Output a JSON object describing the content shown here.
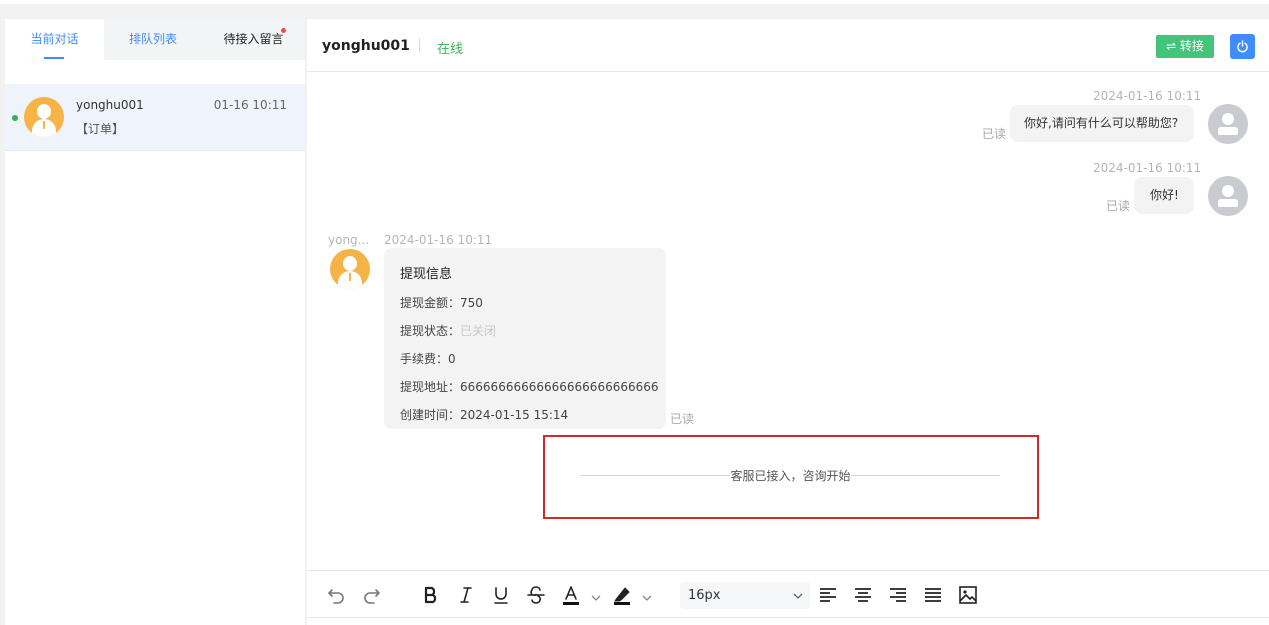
{
  "sidebar": {
    "tabs": [
      {
        "label": "当前对话"
      },
      {
        "label": "排队列表"
      },
      {
        "label": "待接入留言"
      }
    ],
    "conversation": {
      "name": "yonghu001",
      "time": "01-16 10:11",
      "preview": "【订单】"
    }
  },
  "chat": {
    "header": {
      "name": "yonghu001",
      "status": "在线",
      "transfer_label": "⇌ 转接",
      "power_icon": "power-icon"
    },
    "messages": [
      {
        "side": "right",
        "time": "2024-01-16 10:11",
        "text": "你好,请问有什么可以帮助您?",
        "read": "已读"
      },
      {
        "side": "right",
        "time": "2024-01-16 10:11",
        "text": "你好!",
        "read": "已读"
      }
    ],
    "card_message": {
      "sender": "yong...",
      "time": "2024-01-16 10:11",
      "title": "提现信息",
      "rows": [
        {
          "label": "提现金额：",
          "value": "750"
        },
        {
          "label": "提现状态：",
          "value": "已关闭"
        },
        {
          "label": "手续费：",
          "value": "0"
        },
        {
          "label": "提现地址：",
          "value": "66666666666666666666666666"
        },
        {
          "label": "创建时间：",
          "value": "2024-01-15 15:14"
        }
      ],
      "read": "已读"
    },
    "system_notice": "客服已接入，咨询开始"
  },
  "editor": {
    "toolbar_icons": [
      "undo-icon",
      "redo-icon",
      "bold-icon",
      "italic-icon",
      "underline-icon",
      "strikethrough-icon",
      "font-color-icon",
      "highlight-icon",
      "align-left-icon",
      "align-center-icon",
      "align-right-icon",
      "justify-icon",
      "image-icon"
    ],
    "font_size": "16px"
  },
  "colors": {
    "accent": "#3f8cff",
    "online": "#40b35a",
    "transfer_button": "#44c47b",
    "avatar_orange": "#f5b445",
    "highlight_box": "#d22a2a"
  }
}
